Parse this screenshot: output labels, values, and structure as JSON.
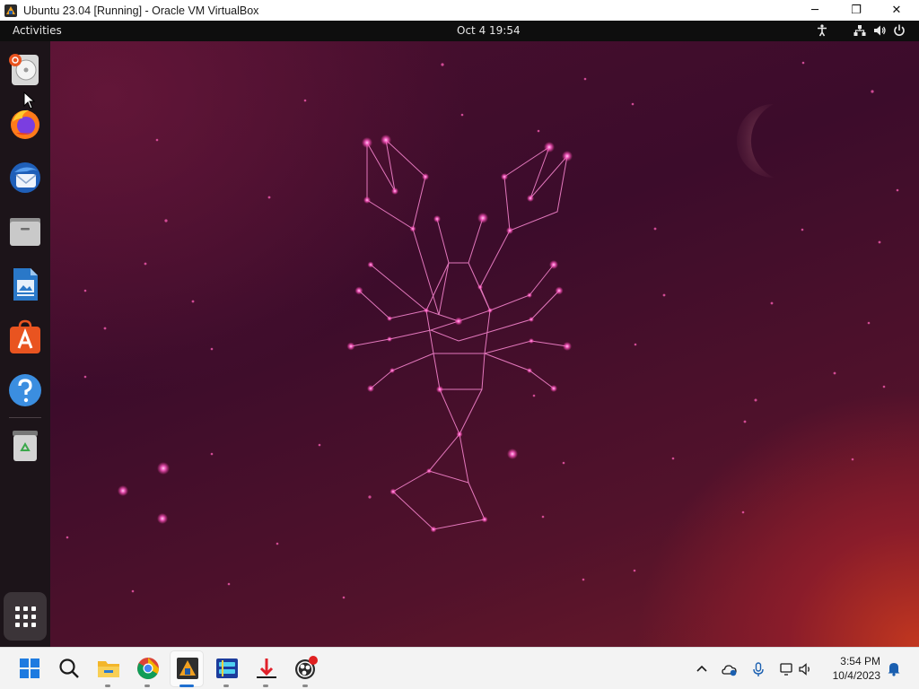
{
  "window": {
    "title": "Ubuntu 23.04 [Running] - Oracle VM VirtualBox",
    "controls": {
      "minimize": "─",
      "maximize": "❐",
      "close": "✕"
    }
  },
  "ubuntu_topbar": {
    "activities": "Activities",
    "clock": "Oct 4  19:54",
    "tray_icons": [
      "accessibility-icon",
      "network-icon",
      "volume-icon",
      "power-icon"
    ]
  },
  "dock": {
    "items": [
      {
        "name": "installer",
        "icon": "ubuntu-installer-icon"
      },
      {
        "name": "firefox",
        "icon": "firefox-icon"
      },
      {
        "name": "thunderbird",
        "icon": "thunderbird-icon"
      },
      {
        "name": "files",
        "icon": "files-icon"
      },
      {
        "name": "libreoffice-writer",
        "icon": "writer-icon"
      },
      {
        "name": "app-center",
        "icon": "app-center-icon"
      },
      {
        "name": "help",
        "icon": "help-icon"
      },
      {
        "name": "trash",
        "icon": "trash-icon"
      }
    ],
    "show_apps": "apps-grid-icon"
  },
  "taskbar": {
    "apps": [
      "start-icon",
      "search-icon",
      "file-explorer-icon",
      "chrome-icon",
      "virtualbox-icon",
      "virtualbox-manager-icon",
      "red-arrow-app-icon",
      "obs-icon"
    ],
    "tray": [
      "chevron-up-icon",
      "onedrive-icon",
      "microphone-icon",
      "display-icon",
      "speaker-icon",
      "notification-bell-icon"
    ],
    "time": "3:54 PM",
    "date": "10/4/2023"
  },
  "colors": {
    "ubuntu_topbar": "#0e0e0e",
    "dock": "#1c1419",
    "wallpaper_base": "#3c0c2b",
    "constellation": "#ff6fd0"
  }
}
